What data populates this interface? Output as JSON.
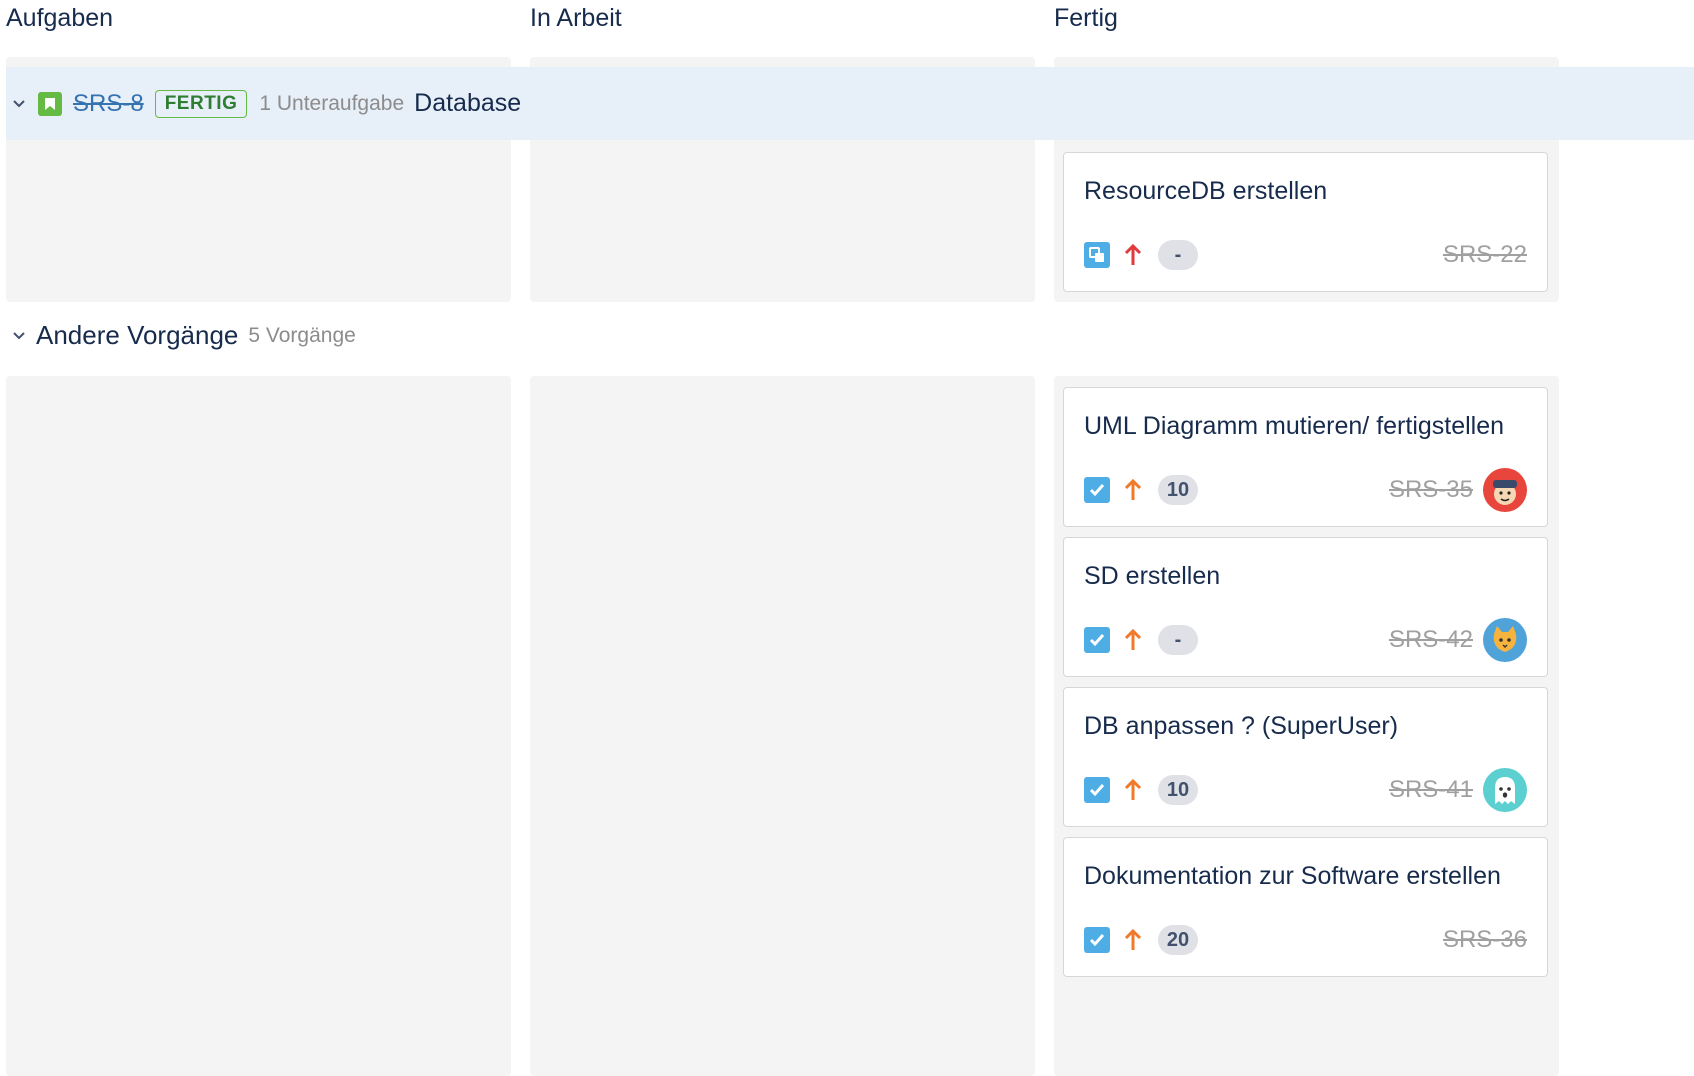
{
  "columns": [
    {
      "title": "Aufgaben"
    },
    {
      "title": "In Arbeit"
    },
    {
      "title": "Fertig"
    }
  ],
  "story": {
    "key": "SRS-8",
    "status": "FERTIG",
    "subtask_count": "1 Unteraufgabe",
    "summary": "Database",
    "icon": "story-bookmark-icon"
  },
  "story_cards": [
    {
      "title": "ResourceDB erstellen",
      "type_icon": "subtask-icon",
      "priority_icon": "priority-high-arrow-icon",
      "estimate": "-",
      "key": "SRS-22"
    }
  ],
  "group": {
    "title": "Andere Vorgänge",
    "count": "5 Vorgänge"
  },
  "cards": [
    {
      "title": "UML Diagramm mutieren/ fertigstellen",
      "type_icon": "task-checkbox-icon",
      "priority_icon": "priority-medium-arrow-icon",
      "estimate": "10",
      "key": "SRS-35",
      "avatar": "avatar-boy-icon"
    },
    {
      "title": "SD erstellen",
      "type_icon": "task-checkbox-icon",
      "priority_icon": "priority-medium-arrow-icon",
      "estimate": "-",
      "key": "SRS-42",
      "avatar": "avatar-cat-icon"
    },
    {
      "title": "DB anpassen ? (SuperUser)",
      "type_icon": "task-checkbox-icon",
      "priority_icon": "priority-medium-arrow-icon",
      "estimate": "10",
      "key": "SRS-41",
      "avatar": "avatar-ghost-icon"
    },
    {
      "title": "Dokumentation zur Software erstellen",
      "type_icon": "task-checkbox-icon",
      "priority_icon": "priority-medium-arrow-icon",
      "estimate": "20",
      "key": "SRS-36"
    }
  ],
  "colors": {
    "story_green": "#65ba43",
    "priority_high": "#e0393e",
    "priority_medium": "#f07a2a",
    "task_blue": "#4fade6",
    "link_blue": "#3572b0"
  }
}
